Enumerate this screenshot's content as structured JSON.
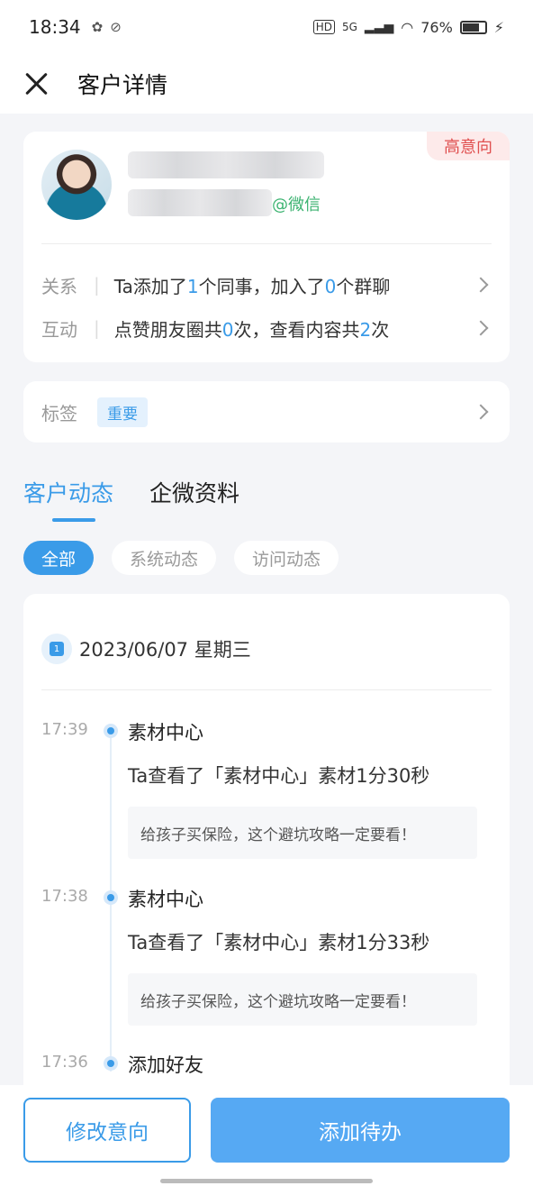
{
  "status_bar": {
    "time": "18:34",
    "network": "5G",
    "battery": "76%",
    "battery_level": 0.76
  },
  "header": {
    "title": "客户详情"
  },
  "profile": {
    "wechat_label": "@微信",
    "intent_badge": "高意向"
  },
  "relations": {
    "relation_label": "关系",
    "relation_text_1": "Ta添加了",
    "relation_num_1": "1",
    "relation_text_2": "个同事，加入了",
    "relation_num_2": "0",
    "relation_text_3": "个群聊",
    "interaction_label": "互动",
    "interaction_text_1": "点赞朋友圈共",
    "interaction_num_1": "0",
    "interaction_text_2": "次，查看内容共",
    "interaction_num_2": "2",
    "interaction_text_3": "次"
  },
  "tags": {
    "label": "标签",
    "tag": "重要"
  },
  "tabs": [
    "客户动态",
    "企微资料"
  ],
  "filters": [
    "全部",
    "系统动态",
    "访问动态"
  ],
  "timeline": {
    "date": "2023/06/07 星期三",
    "items": [
      {
        "time": "17:39",
        "title": "素材中心",
        "desc": "Ta查看了「素材中心」素材1分30秒",
        "content": "给孩子买保险，这个避坑攻略一定要看！"
      },
      {
        "time": "17:38",
        "title": "素材中心",
        "desc": "Ta查看了「素材中心」素材1分33秒",
        "content": "给孩子买保险，这个避坑攻略一定要看！"
      },
      {
        "time": "17:36",
        "title": "添加好友"
      }
    ]
  },
  "bottom": {
    "edit_button": "修改意向",
    "add_button": "添加待办"
  },
  "colors": {
    "accent": "#3a9be8",
    "badge_red": "#e05050",
    "wechat_green": "#3cb371"
  }
}
